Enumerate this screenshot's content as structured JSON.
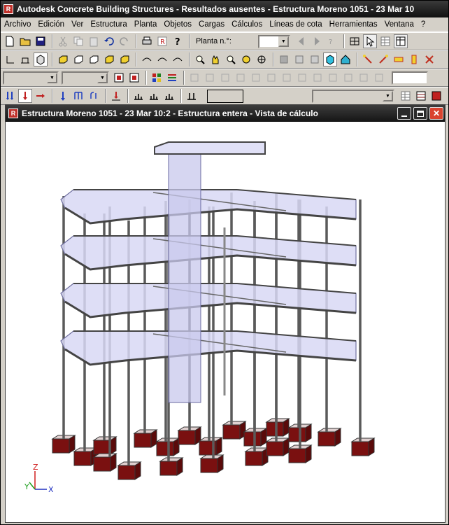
{
  "app": {
    "title": "Autodesk Concrete Building Structures - Resultados ausentes - Estructura Moreno 1051 - 23 Mar 10",
    "logo": "R"
  },
  "menu": [
    "Archivo",
    "Edición",
    "Ver",
    "Estructura",
    "Planta",
    "Objetos",
    "Cargas",
    "Cálculos",
    "Líneas de cota",
    "Herramientas",
    "Ventana",
    "?"
  ],
  "toolbar": {
    "planta_label": "Planta n.°:",
    "planta_value": ""
  },
  "child": {
    "title": "Estructura Moreno 1051 - 23 Mar 10:2 - Estructura entera - Vista de cálculo",
    "logo": "R"
  },
  "axes": {
    "x": "X",
    "y": "Y",
    "z": "Z"
  },
  "colors": {
    "titlebar": "#1e1e1e",
    "slab": "#d8d8f4",
    "slabEdge": "#7070a0",
    "footing": "#7a1010",
    "column": "#5a5a5a",
    "close": "#d9432f"
  }
}
